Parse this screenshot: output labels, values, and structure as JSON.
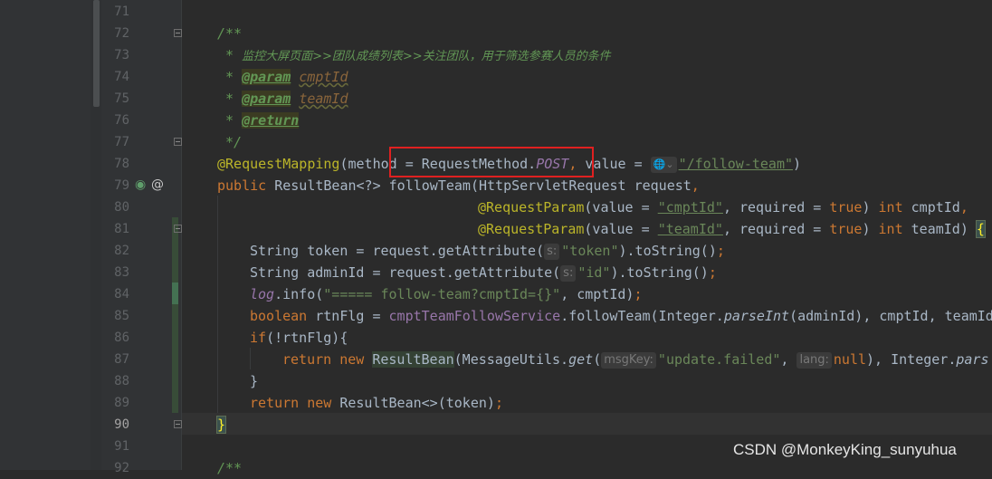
{
  "editor": {
    "line_numbers": [
      "71",
      "72",
      "73",
      "74",
      "75",
      "76",
      "77",
      "78",
      "79",
      "80",
      "81",
      "82",
      "83",
      "84",
      "85",
      "86",
      "87",
      "88",
      "89",
      "90",
      "91",
      "92"
    ],
    "current_line": "90",
    "colors": {
      "background": "#2b2b2b",
      "gutter": "#313335",
      "keyword": "#cc7832",
      "annotation": "#bbb529",
      "string": "#6a8759",
      "doc": "#629755",
      "highlight_box": "#e02020"
    },
    "code": {
      "l72": "/**",
      "l73_star": " * ",
      "l73_text": "监控大屏页面>>团队成绩列表>>关注团队，用于筛选参赛人员的条件",
      "l74_star": " * ",
      "l74_tag": "@param",
      "l74_name": "cmptId",
      "l75_star": " * ",
      "l75_tag": "@param",
      "l75_name": "teamId",
      "l76_star": " * ",
      "l76_tag": "@return",
      "l77": " */",
      "l78_ann": "@RequestMapping",
      "l78_a": "(method = RequestMethod.",
      "l78_post": "POST",
      "l78_comma": ",",
      "l78_b": " value = ",
      "l78_val": "\"/follow-team\"",
      "l78_c": ")",
      "l79_kw": "public ",
      "l79_a": "ResultBean<?> followTeam(HttpServletRequest request",
      "l79_comma": ",",
      "l80_ann": "@RequestParam",
      "l80_a": "(value = ",
      "l80_val": "\"cmptId\"",
      "l80_b": ", required = ",
      "l80_true": "true",
      "l80_c": ") ",
      "l80_int": "int ",
      "l80_d": "cmptId",
      "l80_comma": ",",
      "l81_ann": "@RequestParam",
      "l81_a": "(value = ",
      "l81_val": "\"teamId\"",
      "l81_b": ", required = ",
      "l81_true": "true",
      "l81_c": ") ",
      "l81_int": "int ",
      "l81_d": "teamId) ",
      "l81_brace": "{",
      "l82_a": "String token = request.getAttribute(",
      "l82_hint": "s:",
      "l82_val": "\"token\"",
      "l82_b": ").toString()",
      "l82_semi": ";",
      "l83_a": "String adminId = request.getAttribute(",
      "l83_hint": "s:",
      "l83_val": "\"id\"",
      "l83_b": ").toString()",
      "l83_semi": ";",
      "l84_log": "log",
      "l84_a": ".info(",
      "l84_val": "\"===== follow-team?cmptId={}\"",
      "l84_b": ", cmptId)",
      "l84_semi": ";",
      "l85_kw": "boolean ",
      "l85_a": "rtnFlg = ",
      "l85_svc": "cmptTeamFollowService",
      "l85_b": ".followTeam(Integer.",
      "l85_m": "parseInt",
      "l85_c": "(adminId), cmptId, teamId",
      "l86_kw": "if",
      "l86_a": "(!rtnFlg){",
      "l87_kw": "return new ",
      "l87_cls": "ResultBean",
      "l87_a": "(MessageUtils.",
      "l87_m": "get",
      "l87_b": "(",
      "l87_hint1": "msgKey:",
      "l87_val": "\"update.failed\"",
      "l87_c": ", ",
      "l87_hint2": "lang:",
      "l87_null": "null",
      "l87_d": "), Integer.",
      "l87_m2": "pars",
      "l88": "}",
      "l89_kw": "return new ",
      "l89_a": "ResultBean<>(token)",
      "l89_semi": ";",
      "l90": "}",
      "l92": "/**"
    }
  },
  "watermark": "CSDN @MonkeyKing_sunyuhua",
  "icons": {
    "gutter_line_79": [
      "web-endpoint-icon",
      "at-sign-icon"
    ],
    "line_78_value": "globe-icon"
  }
}
